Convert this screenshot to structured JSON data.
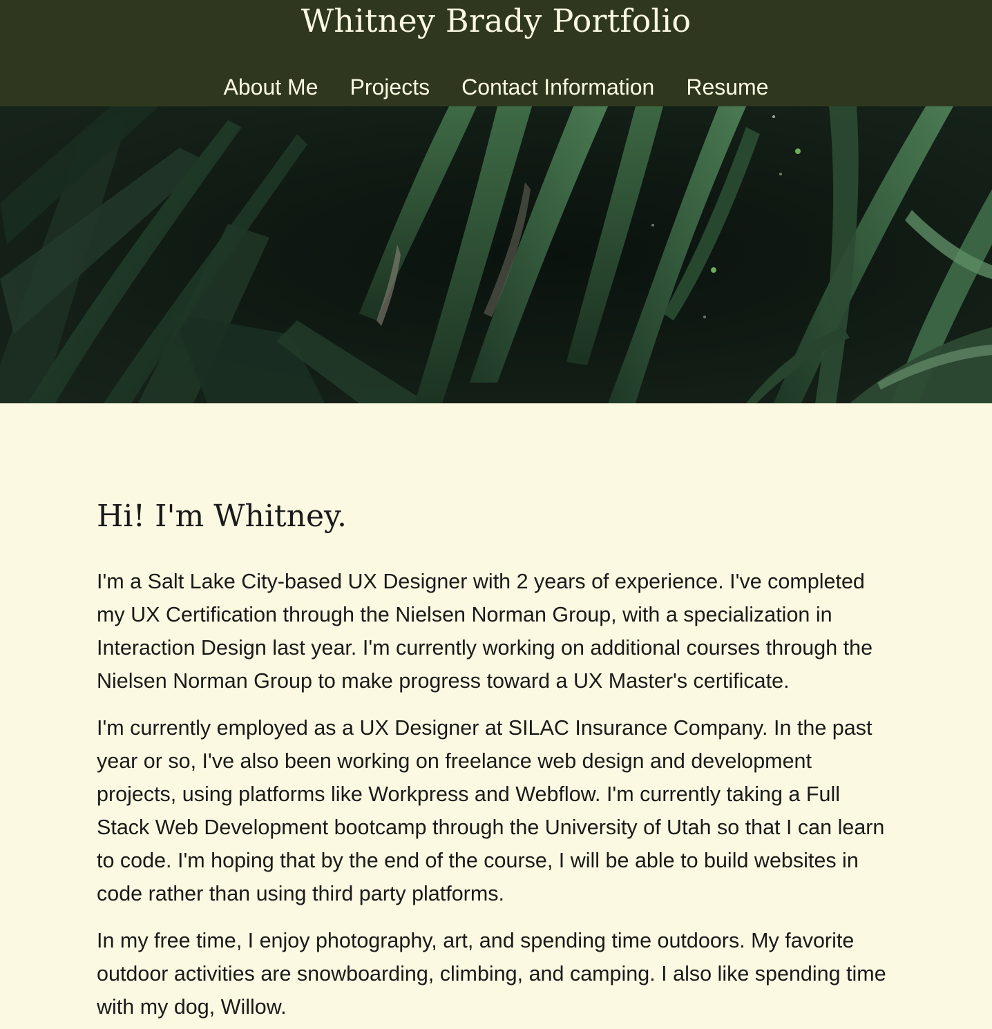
{
  "header": {
    "title": "Whitney Brady Portfolio",
    "nav": [
      {
        "label": "About Me"
      },
      {
        "label": "Projects"
      },
      {
        "label": "Contact Information"
      },
      {
        "label": "Resume"
      }
    ]
  },
  "hero": {
    "image": "dark-tropical-leaves-photo"
  },
  "about": {
    "heading": "Hi! I'm Whitney.",
    "paragraphs": [
      "I'm a Salt Lake City-based UX Designer with 2 years of experience. I've completed my UX Certification through the Nielsen Norman Group, with a specialization in Interaction Design last year. I'm currently working on additional courses through the Nielsen Norman Group to make progress toward a UX Master's certificate.",
      "I'm currently employed as a UX Designer at SILAC Insurance Company. In the past year or so, I've also been working on freelance web design and development projects, using platforms like Workpress and Webflow. I'm currently taking a Full Stack Web Development bootcamp through the University of Utah so that I can learn to code. I'm hoping that by the end of the course, I will be able to build websites in code rather than using third party platforms.",
      "In my free time, I enjoy photography, art, and spending time outdoors. My favorite outdoor activities are snowboarding, climbing, and camping. I also like spending time with my dog, Willow."
    ]
  },
  "colors": {
    "header_bg": "#2f381e",
    "header_text": "#fbf9e1",
    "page_bg": "#fbf9e1",
    "body_text": "#1a1a1a"
  }
}
